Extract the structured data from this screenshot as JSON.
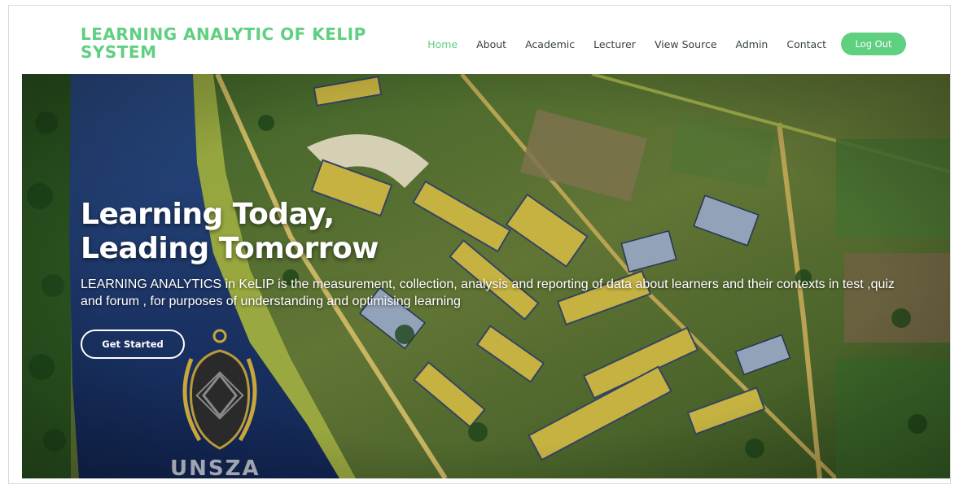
{
  "brand": {
    "line1": "LEARNING ANALYTIC OF KELIP",
    "line2": "SYSTEM"
  },
  "nav": {
    "items": [
      {
        "label": "Home",
        "active": true
      },
      {
        "label": "About",
        "active": false
      },
      {
        "label": "Academic",
        "active": false
      },
      {
        "label": "Lecturer",
        "active": false
      },
      {
        "label": "View Source",
        "active": false
      },
      {
        "label": "Admin",
        "active": false
      },
      {
        "label": "Contact",
        "active": false
      }
    ],
    "logout_label": "Log Out"
  },
  "hero": {
    "title_line1": "Learning Today,",
    "title_line2": "Leading Tomorrow",
    "description": "LEARNING ANALYTICS in KeLIP is the measurement, collection, analysis and reporting of data about learners and their contexts in test ,quiz and forum , for purposes of understanding and optimising learning",
    "cta_label": "Get Started",
    "emblem_text": "UNSZA"
  },
  "colors": {
    "accent": "#5fcf80",
    "nav_text": "#37423b"
  }
}
